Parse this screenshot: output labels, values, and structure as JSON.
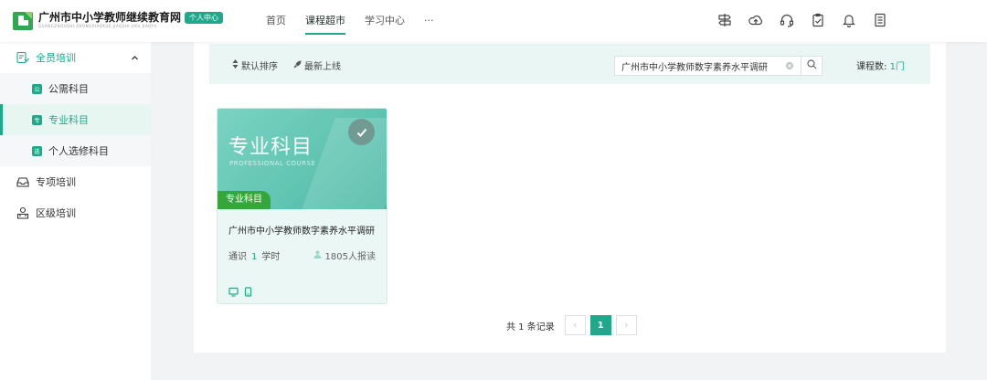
{
  "brand": {
    "title": "广州市中小学教师继续教育网",
    "subtitle": "GUANGZHOUSHI ZHONGXIAOXUE JIAOSHI JIXU JIAOYU",
    "badge": "个人中心",
    "color": "#21a88a"
  },
  "nav": {
    "items": [
      {
        "label": "首页",
        "active": false
      },
      {
        "label": "课程超市",
        "active": true
      },
      {
        "label": "学习中心",
        "active": false
      },
      {
        "label": "···",
        "active": false
      }
    ]
  },
  "toolbar_icons": [
    "signpost-icon",
    "cloud-upload-icon",
    "headset-icon",
    "clipboard-check-icon",
    "bell-icon",
    "document-icon"
  ],
  "sidebar": {
    "group1": {
      "label": "全员培训",
      "icon": "training-icon",
      "expanded": true
    },
    "subitems": [
      {
        "label": "公需科目",
        "mark": "公",
        "active": false
      },
      {
        "label": "专业科目",
        "mark": "专",
        "active": true
      },
      {
        "label": "个人选修科目",
        "mark": "选",
        "active": false
      }
    ],
    "group2": {
      "label": "专项培训",
      "icon": "inbox-icon"
    },
    "group3": {
      "label": "区级培训",
      "icon": "region-icon"
    }
  },
  "filter": {
    "sort_default": "默认排序",
    "sort_latest": "最新上线",
    "search_value": "广州市中小学教师数字素养水平调研",
    "count_label": "课程数:",
    "count_value": "1门"
  },
  "course": {
    "cover_title": "专业科目",
    "cover_subtitle": "PROFESSIONAL COURSE",
    "tag": "专业科目",
    "title": "广州市中小学教师数字素养水平调研",
    "category": "通识",
    "hours": "1",
    "hours_unit": "学时",
    "readers": "1805人报读"
  },
  "pagination": {
    "summary": "共 1 条记录",
    "current_page": "1",
    "prev": "‹",
    "next": "›"
  }
}
